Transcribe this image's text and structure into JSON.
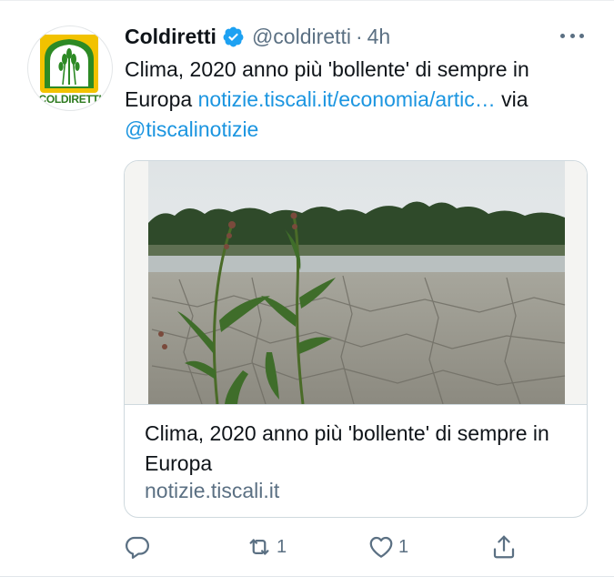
{
  "tweet": {
    "display_name": "Coldiretti",
    "handle": "@coldiretti",
    "separator": "·",
    "time": "4h",
    "avatar_text": "COLDIRETTI",
    "text_prefix": "Clima, 2020 anno più 'bollente' di sempre in Europa ",
    "link_text": "notizie.tiscali.it/economia/artic…",
    "via_text": " via ",
    "mention": "@tiscalinotizie"
  },
  "card": {
    "title": "Clima, 2020 anno più 'bollente' di sempre in Europa",
    "domain": "notizie.tiscali.it"
  },
  "actions": {
    "reply_count": "",
    "retweet_count": "1",
    "like_count": "1"
  },
  "colors": {
    "accent": "#1b95e0",
    "secondary_text": "#5b7083",
    "verified": "#1da1f2",
    "brand_green": "#2d7a1f",
    "brand_yellow": "#f2c200"
  },
  "icons": [
    "verified-badge-icon",
    "more-icon",
    "reply-icon",
    "retweet-icon",
    "like-icon",
    "share-icon"
  ]
}
